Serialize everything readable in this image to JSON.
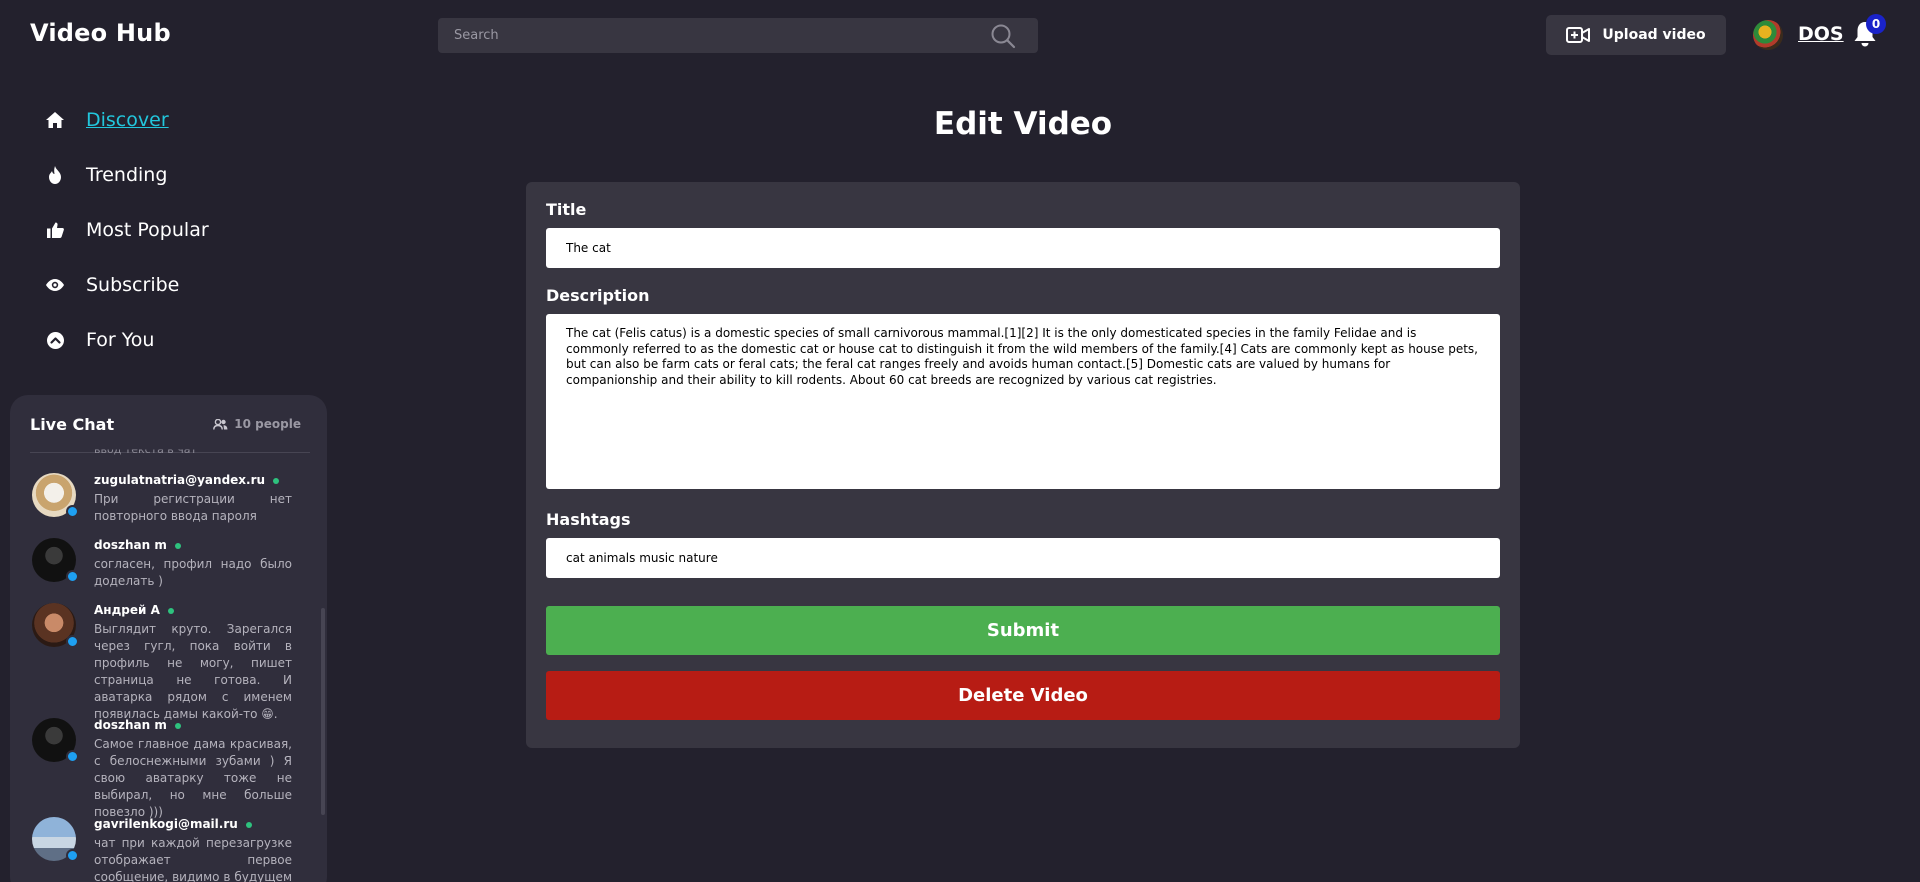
{
  "header": {
    "logo": "Video Hub",
    "search_placeholder": "Search",
    "upload_label": "Upload video",
    "user_name": "DOS",
    "notification_count": "0"
  },
  "nav": {
    "items": [
      {
        "label": "Discover",
        "icon": "home-icon",
        "active": true
      },
      {
        "label": "Trending",
        "icon": "flame-icon",
        "active": false
      },
      {
        "label": "Most Popular",
        "icon": "thumbs-up-icon",
        "active": false
      },
      {
        "label": "Subscribe",
        "icon": "eye-icon",
        "active": false
      },
      {
        "label": "For You",
        "icon": "chevron-up-circle-icon",
        "active": false
      }
    ]
  },
  "chat": {
    "title": "Live Chat",
    "people": "10 people",
    "cut_text": "ввод текста в чат",
    "messages": [
      {
        "name": "zugulatnatria@yandex.ru",
        "text": "При регистрации нет повторного ввода пароля"
      },
      {
        "name": "doszhan m",
        "text": "согласен, профил надо было доделать )"
      },
      {
        "name": "Андрей А",
        "text": "Выглядит круто. Зарегался через гугл, пока войти в профиль не могу, пишет страница не готова. И аватарка рядом с именем появилась дамы какой-то 😁."
      },
      {
        "name": "doszhan m",
        "text": "Самое главное дама красивая, с белоснежными зубами ) Я свою аватарку тоже не выбирал, но мне больше повезло )))"
      },
      {
        "name": "gavrilenkogi@mail.ru",
        "text": "чат при каждой перезагрузке отображает первое сообщение, видимо в будущем придется всю"
      }
    ]
  },
  "main": {
    "title": "Edit Video",
    "title_label": "Title",
    "title_value": "The cat",
    "description_label": "Description",
    "description_value": "The cat (Felis catus) is a domestic species of small carnivorous mammal.[1][2] It is the only domesticated species in the family Felidae and is commonly referred to as the domestic cat or house cat to distinguish it from the wild members of the family.[4] Cats are commonly kept as house pets, but can also be farm cats or feral cats; the feral cat ranges freely and avoids human contact.[5] Domestic cats are valued by humans for companionship and their ability to kill rodents. About 60 cat breeds are recognized by various cat registries.",
    "hashtags_label": "Hashtags",
    "hashtags_value": "cat animals music nature",
    "submit_label": "Submit",
    "delete_label": "Delete Video"
  },
  "colors": {
    "background": "#23212d",
    "panel": "#383641",
    "accent": "#22c6dc",
    "submit": "#4caf50",
    "delete": "#b71c14"
  }
}
